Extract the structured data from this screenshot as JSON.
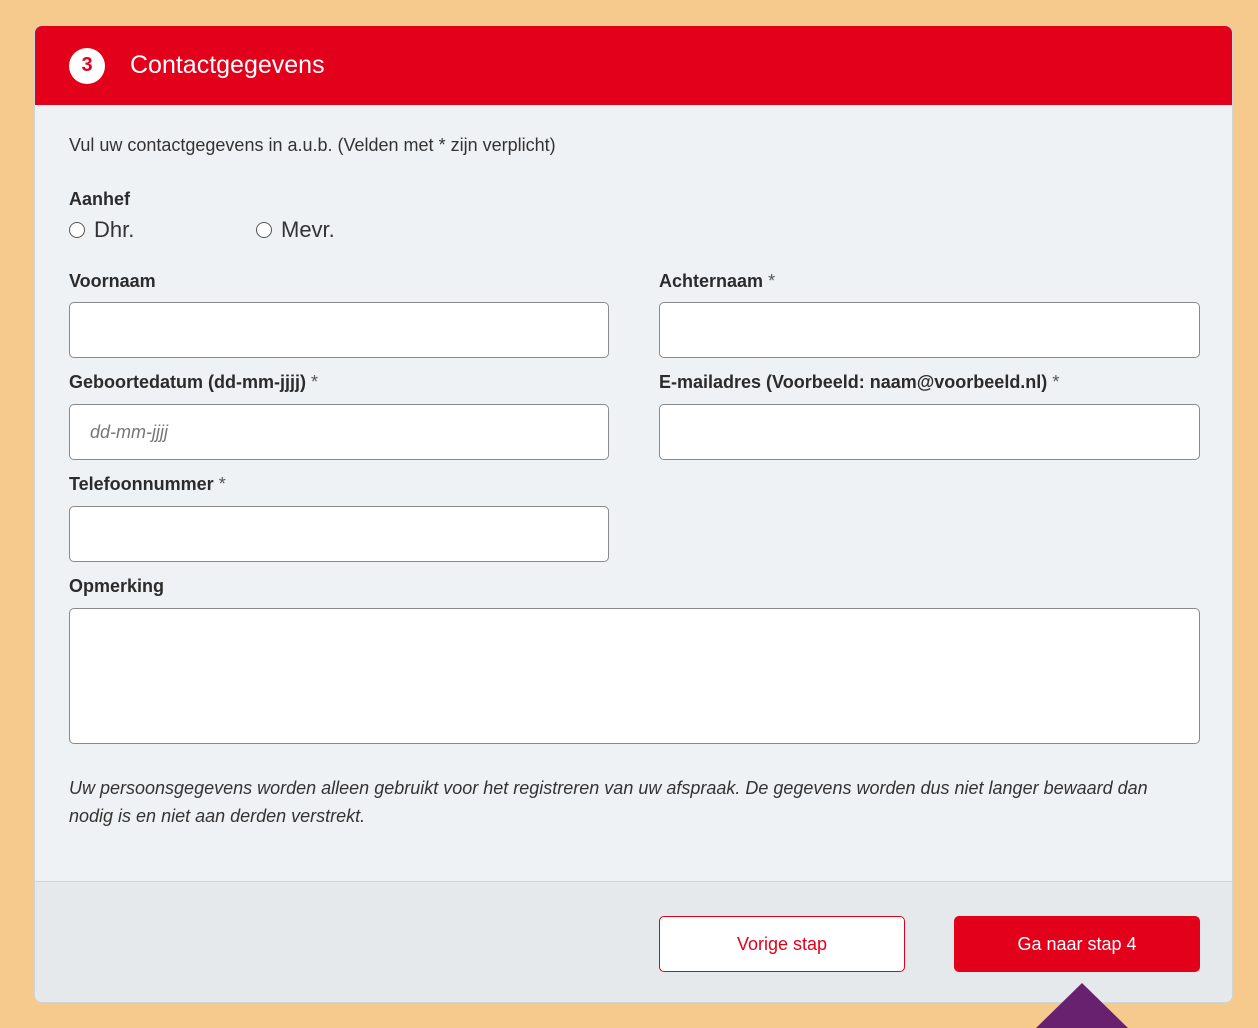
{
  "header": {
    "step_number": "3",
    "title": "Contactgegevens"
  },
  "intro": "Vul uw contactgegevens in a.u.b. (Velden met * zijn verplicht)",
  "salutation": {
    "label": "Aanhef",
    "options": [
      "Dhr.",
      "Mevr."
    ]
  },
  "fields": {
    "firstname": {
      "label": "Voornaam",
      "value": ""
    },
    "lastname": {
      "label": "Achternaam",
      "required": "*",
      "value": ""
    },
    "birthdate": {
      "label": "Geboortedatum (dd-mm-jjjj)",
      "required": "*",
      "placeholder": "dd-mm-jjjj",
      "value": ""
    },
    "email": {
      "label": "E-mailadres (Voorbeeld: naam@voorbeeld.nl)",
      "required": "*",
      "value": ""
    },
    "phone": {
      "label": "Telefoonnummer",
      "required": "*",
      "value": ""
    },
    "remark": {
      "label": "Opmerking",
      "value": ""
    }
  },
  "notice": "Uw persoonsgegevens worden alleen gebruikt voor het registreren van uw afspraak. De gegevens worden dus niet langer bewaard dan nodig is en niet aan derden verstrekt.",
  "buttons": {
    "prev": "Vorige stap",
    "next": "Ga naar stap 4"
  },
  "colors": {
    "brand_red": "#e2001a",
    "page_background": "#f6c98c",
    "arrow": "#68216e"
  }
}
